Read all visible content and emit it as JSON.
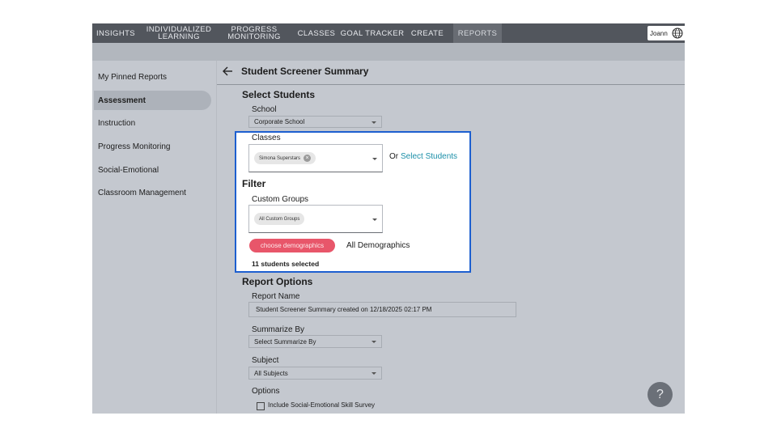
{
  "nav": {
    "items": [
      {
        "label": "INSIGHTS",
        "active": false
      },
      {
        "line1": "INDIVIDUALIZED",
        "line2": "LEARNING",
        "active": false
      },
      {
        "line1": "PROGRESS",
        "line2": "MONITORING",
        "active": false
      },
      {
        "label": "CLASSES",
        "active": false
      },
      {
        "label": "GOAL TRACKER",
        "active": false
      },
      {
        "label": "CREATE",
        "active": false
      },
      {
        "label": "REPORTS",
        "active": true
      }
    ],
    "user": "Joann",
    "language_icon": "globe-icon"
  },
  "sidebar": {
    "items": [
      {
        "label": "My Pinned Reports",
        "active": false
      },
      {
        "label": "Assessment",
        "active": true
      },
      {
        "label": "Instruction",
        "active": false
      },
      {
        "label": "Progress Monitoring",
        "active": false
      },
      {
        "label": "Social-Emotional",
        "active": false
      },
      {
        "label": "Classroom Management",
        "active": false
      }
    ]
  },
  "page": {
    "title": "Student Screener Summary",
    "back_icon": "arrow-left-icon"
  },
  "select_students": {
    "heading": "Select Students",
    "school_label": "School",
    "school_value": "Corporate School",
    "classes_label": "Classes",
    "classes_chip": "Simona Superstars",
    "or_text": "Or",
    "select_students_link": "Select Students"
  },
  "filter": {
    "heading": "Filter",
    "custom_groups_label": "Custom Groups",
    "custom_groups_chip": "All Custom Groups",
    "demographics_button": "choose demographics",
    "demographics_value": "All Demographics",
    "selected_count": "11 students selected"
  },
  "report_options": {
    "heading": "Report Options",
    "report_name_label": "Report Name",
    "report_name_value": "Student Screener Summary created on 12/18/2025 02:17 PM",
    "summarize_label": "Summarize By",
    "summarize_value": "Select Summarize By",
    "subject_label": "Subject",
    "subject_value": "All Subjects",
    "options_label": "Options",
    "option_1": "Include Social-Emotional Skill Survey",
    "option_1_checked": false
  },
  "help": {
    "label": "?"
  },
  "colors": {
    "nav_bg": "#52565d",
    "page_bg": "#c4c8cf",
    "highlight_border": "#1d5fd0",
    "demographics_button": "#e8566a",
    "link": "#1b8fa8"
  }
}
